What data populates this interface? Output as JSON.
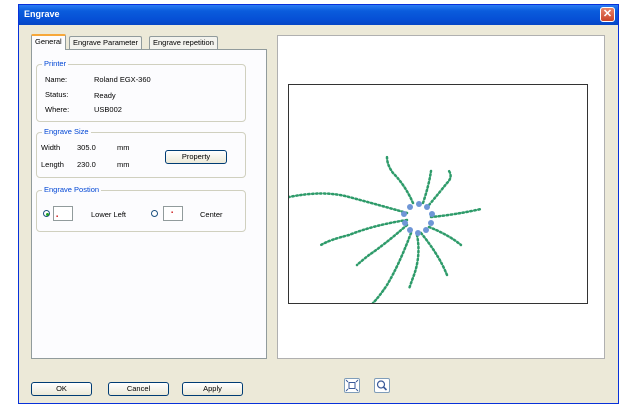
{
  "window": {
    "title": "Engrave",
    "close_glyph": "✕"
  },
  "tabs": [
    {
      "label": "General",
      "active": true
    },
    {
      "label": "Engrave Parameter",
      "active": false
    },
    {
      "label": "Engrave repetition",
      "active": false
    }
  ],
  "printer": {
    "title": "Printer",
    "name_label": "Name:",
    "name_value": "Roland EGX-360",
    "status_label": "Status:",
    "status_value": "Ready",
    "where_label": "Where:",
    "where_value": "USB002"
  },
  "engrave_size": {
    "title": "Engrave Size",
    "width_label": "Width",
    "width_value": "305.0",
    "width_unit": "mm",
    "length_label": "Length",
    "length_value": "230.0",
    "length_unit": "mm",
    "property_label": "Property"
  },
  "engrave_position": {
    "title": "Engrave Postion",
    "lower_left_label": "Lower Left",
    "center_label": "Center",
    "selected": "lower_left"
  },
  "buttons": {
    "ok": "OK",
    "cancel": "Cancel",
    "apply": "Apply"
  },
  "toolbar_icons": [
    "fit-to-view-icon",
    "zoom-icon"
  ],
  "colors": {
    "titlebar": "#0a5cdc",
    "dialog_bg": "#ece9d8",
    "group_title": "#0046d5",
    "tendril": "#2e9b6a",
    "ring": "#6f96d6"
  }
}
